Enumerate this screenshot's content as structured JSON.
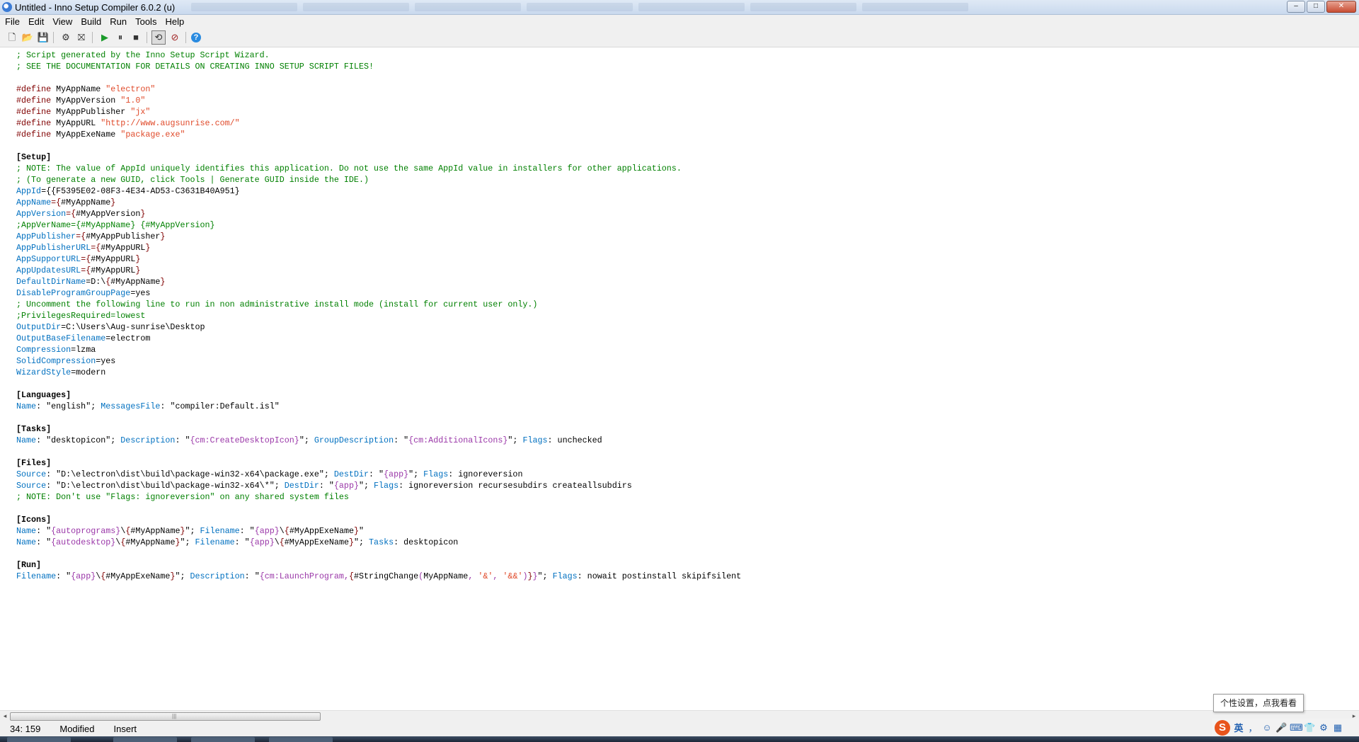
{
  "window": {
    "title": "Untitled - Inno Setup Compiler 6.0.2 (u)",
    "controls": {
      "minimize": "–",
      "maximize": "□",
      "close": "✕"
    }
  },
  "menu": [
    "File",
    "Edit",
    "View",
    "Build",
    "Run",
    "Tools",
    "Help"
  ],
  "toolbar": {
    "buttons": [
      {
        "name": "new-file-icon",
        "glyph": "🗋"
      },
      {
        "name": "open-file-icon",
        "glyph": "📂"
      },
      {
        "name": "save-icon",
        "glyph": "💾"
      },
      {
        "name": "compile-icon",
        "glyph": "⚙"
      },
      {
        "name": "stop-compile-icon",
        "glyph": "⛝"
      },
      {
        "name": "run-icon",
        "glyph": "▶"
      },
      {
        "name": "pause-icon",
        "glyph": "⏸"
      },
      {
        "name": "stop-icon",
        "glyph": "■"
      },
      {
        "name": "debug-target-icon",
        "glyph": "⟲"
      },
      {
        "name": "uninstall-icon",
        "glyph": "⊘"
      },
      {
        "name": "help-icon",
        "glyph": "?"
      }
    ]
  },
  "editor": {
    "lines": [
      [
        [
          "cmt",
          "; Script generated by the Inno Setup Script Wizard."
        ]
      ],
      [
        [
          "cmt",
          "; SEE THE DOCUMENTATION FOR DETAILS ON CREATING INNO SETUP SCRIPT FILES!"
        ]
      ],
      [],
      [
        [
          "kw",
          "#define"
        ],
        [
          "txt",
          " MyAppName "
        ],
        [
          "str",
          "\"electron\""
        ]
      ],
      [
        [
          "kw",
          "#define"
        ],
        [
          "txt",
          " MyAppVersion "
        ],
        [
          "str",
          "\"1.0\""
        ]
      ],
      [
        [
          "kw",
          "#define"
        ],
        [
          "txt",
          " MyAppPublisher "
        ],
        [
          "str",
          "\"jx\""
        ]
      ],
      [
        [
          "kw",
          "#define"
        ],
        [
          "txt",
          " MyAppURL "
        ],
        [
          "str",
          "\"http://www.augsunrise.com/\""
        ]
      ],
      [
        [
          "kw",
          "#define"
        ],
        [
          "txt",
          " MyAppExeName "
        ],
        [
          "str",
          "\"package.exe\""
        ]
      ],
      [],
      [
        [
          "sec",
          "[Setup]"
        ]
      ],
      [
        [
          "cmt",
          "; NOTE: The value of AppId uniquely identifies this application. Do not use the same AppId value in installers for other applications."
        ]
      ],
      [
        [
          "cmt",
          "; (To generate a new GUID, click Tools | Generate GUID inside the IDE.)"
        ]
      ],
      [
        [
          "par",
          "AppId"
        ],
        [
          "txt",
          "={{F5395E02-08F3-4E34-AD53-C3631B40A951}"
        ]
      ],
      [
        [
          "par",
          "AppName"
        ],
        [
          "kw",
          "={"
        ],
        [
          "txt",
          "#MyAppName"
        ],
        [
          "kw",
          "}"
        ]
      ],
      [
        [
          "par",
          "AppVersion"
        ],
        [
          "kw",
          "={"
        ],
        [
          "txt",
          "#MyAppVersion"
        ],
        [
          "kw",
          "}"
        ]
      ],
      [
        [
          "cmt",
          ";AppVerName={#MyAppName} {#MyAppVersion}"
        ]
      ],
      [
        [
          "par",
          "AppPublisher"
        ],
        [
          "kw",
          "={"
        ],
        [
          "txt",
          "#MyAppPublisher"
        ],
        [
          "kw",
          "}"
        ]
      ],
      [
        [
          "par",
          "AppPublisherURL"
        ],
        [
          "kw",
          "={"
        ],
        [
          "txt",
          "#MyAppURL"
        ],
        [
          "kw",
          "}"
        ]
      ],
      [
        [
          "par",
          "AppSupportURL"
        ],
        [
          "kw",
          "={"
        ],
        [
          "txt",
          "#MyAppURL"
        ],
        [
          "kw",
          "}"
        ]
      ],
      [
        [
          "par",
          "AppUpdatesURL"
        ],
        [
          "kw",
          "={"
        ],
        [
          "txt",
          "#MyAppURL"
        ],
        [
          "kw",
          "}"
        ]
      ],
      [
        [
          "par",
          "DefaultDirName"
        ],
        [
          "txt",
          "=D:\\"
        ],
        [
          "kw",
          "{"
        ],
        [
          "txt",
          "#MyAppName"
        ],
        [
          "kw",
          "}"
        ]
      ],
      [
        [
          "par",
          "DisableProgramGroupPage"
        ],
        [
          "txt",
          "=yes"
        ]
      ],
      [
        [
          "cmt",
          "; Uncomment the following line to run in non administrative install mode (install for current user only.)"
        ]
      ],
      [
        [
          "cmt",
          ";PrivilegesRequired=lowest"
        ]
      ],
      [
        [
          "par",
          "OutputDir"
        ],
        [
          "txt",
          "=C:\\Users\\Aug-sunrise\\Desktop"
        ]
      ],
      [
        [
          "par",
          "OutputBaseFilename"
        ],
        [
          "txt",
          "=electrom"
        ]
      ],
      [
        [
          "par",
          "Compression"
        ],
        [
          "txt",
          "=lzma"
        ]
      ],
      [
        [
          "par",
          "SolidCompression"
        ],
        [
          "txt",
          "=yes"
        ]
      ],
      [
        [
          "par",
          "WizardStyle"
        ],
        [
          "txt",
          "=modern"
        ]
      ],
      [],
      [
        [
          "sec",
          "[Languages]"
        ]
      ],
      [
        [
          "par",
          "Name"
        ],
        [
          "txt",
          ": \"english\"; "
        ],
        [
          "par",
          "MessagesFile"
        ],
        [
          "txt",
          ": \"compiler:Default.isl\""
        ]
      ],
      [],
      [
        [
          "sec",
          "[Tasks]"
        ]
      ],
      [
        [
          "par",
          "Name"
        ],
        [
          "txt",
          ": \"desktopicon\"; "
        ],
        [
          "par",
          "Description"
        ],
        [
          "txt",
          ": \""
        ],
        [
          "con",
          "{cm:CreateDesktopIcon}"
        ],
        [
          "txt",
          "\"; "
        ],
        [
          "par",
          "GroupDescription"
        ],
        [
          "txt",
          ": \""
        ],
        [
          "con",
          "{cm:AdditionalIcons}"
        ],
        [
          "txt",
          "\"; "
        ],
        [
          "par",
          "Flags"
        ],
        [
          "txt",
          ": unchecked"
        ]
      ],
      [],
      [
        [
          "sec",
          "[Files]"
        ]
      ],
      [
        [
          "par",
          "Source"
        ],
        [
          "txt",
          ": \"D:\\electron\\dist\\build\\package-win32-x64\\package.exe\"; "
        ],
        [
          "par",
          "DestDir"
        ],
        [
          "txt",
          ": \""
        ],
        [
          "con",
          "{app}"
        ],
        [
          "txt",
          "\"; "
        ],
        [
          "par",
          "Flags"
        ],
        [
          "txt",
          ": ignoreversion"
        ]
      ],
      [
        [
          "par",
          "Source"
        ],
        [
          "txt",
          ": \"D:\\electron\\dist\\build\\package-win32-x64\\*\"; "
        ],
        [
          "par",
          "DestDir"
        ],
        [
          "txt",
          ": \""
        ],
        [
          "con",
          "{app}"
        ],
        [
          "txt",
          "\"; "
        ],
        [
          "par",
          "Flags"
        ],
        [
          "txt",
          ": ignoreversion recursesubdirs createallsubdirs"
        ]
      ],
      [
        [
          "cmt",
          "; NOTE: Don't use \"Flags: ignoreversion\" on any shared system files"
        ]
      ],
      [],
      [
        [
          "sec",
          "[Icons]"
        ]
      ],
      [
        [
          "par",
          "Name"
        ],
        [
          "txt",
          ": \""
        ],
        [
          "con",
          "{autoprograms}"
        ],
        [
          "txt",
          "\\"
        ],
        [
          "kw",
          "{"
        ],
        [
          "txt",
          "#MyAppName"
        ],
        [
          "kw",
          "}"
        ],
        [
          "txt",
          "\"; "
        ],
        [
          "par",
          "Filename"
        ],
        [
          "txt",
          ": \""
        ],
        [
          "con",
          "{app}"
        ],
        [
          "txt",
          "\\"
        ],
        [
          "kw",
          "{"
        ],
        [
          "txt",
          "#MyAppExeName"
        ],
        [
          "kw",
          "}"
        ],
        [
          "txt",
          "\""
        ]
      ],
      [
        [
          "par",
          "Name"
        ],
        [
          "txt",
          ": \""
        ],
        [
          "con",
          "{autodesktop}"
        ],
        [
          "txt",
          "\\"
        ],
        [
          "kw",
          "{"
        ],
        [
          "txt",
          "#MyAppName"
        ],
        [
          "kw",
          "}"
        ],
        [
          "txt",
          "\"; "
        ],
        [
          "par",
          "Filename"
        ],
        [
          "txt",
          ": \""
        ],
        [
          "con",
          "{app}"
        ],
        [
          "txt",
          "\\"
        ],
        [
          "kw",
          "{"
        ],
        [
          "txt",
          "#MyAppExeName"
        ],
        [
          "kw",
          "}"
        ],
        [
          "txt",
          "\"; "
        ],
        [
          "par",
          "Tasks"
        ],
        [
          "txt",
          ": desktopicon"
        ]
      ],
      [],
      [
        [
          "sec",
          "[Run]"
        ]
      ],
      [
        [
          "par",
          "Filename"
        ],
        [
          "txt",
          ": \""
        ],
        [
          "con",
          "{app}"
        ],
        [
          "txt",
          "\\"
        ],
        [
          "kw",
          "{"
        ],
        [
          "txt",
          "#MyAppExeName"
        ],
        [
          "kw",
          "}"
        ],
        [
          "txt",
          "\"; "
        ],
        [
          "par",
          "Description"
        ],
        [
          "txt",
          ": \""
        ],
        [
          "con",
          "{cm:LaunchProgram,"
        ],
        [
          "kw",
          "{"
        ],
        [
          "txt",
          "#StringChange"
        ],
        [
          "con",
          "("
        ],
        [
          "txt",
          "MyAppName"
        ],
        [
          "con",
          ", "
        ],
        [
          "str",
          "'&'"
        ],
        [
          "con",
          ", "
        ],
        [
          "str",
          "'&&'"
        ],
        [
          "con",
          ")"
        ],
        [
          "kw",
          "}"
        ],
        [
          "con",
          "}"
        ],
        [
          "txt",
          "\"; "
        ],
        [
          "par",
          "Flags"
        ],
        [
          "txt",
          ": nowait postinstall skipifsilent"
        ]
      ]
    ]
  },
  "scrollbar": {
    "left_arrow": "◂",
    "right_arrow": "▸",
    "grip": "|||"
  },
  "status": {
    "position": "34: 159",
    "modified": "Modified",
    "mode": "Insert"
  },
  "ime": {
    "logo": "S",
    "lang": "英",
    "tooltip": "个性设置，点我看看",
    "icons": [
      "，",
      "☺",
      "🎤",
      "⌨",
      "👕",
      "⚙",
      "▦"
    ]
  },
  "colors": {
    "comment": "#008000",
    "directive": "#800000",
    "string": "#e04a2a",
    "parameter": "#0070c0",
    "constant": "#9a37a8"
  }
}
